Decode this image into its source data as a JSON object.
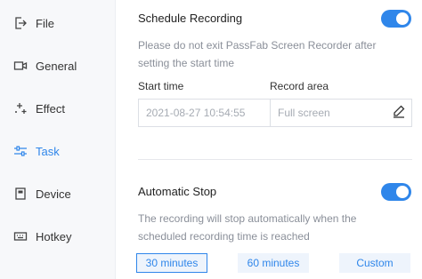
{
  "sidebar": {
    "items": [
      {
        "label": "File",
        "icon": "file-export-icon"
      },
      {
        "label": "General",
        "icon": "video-camera-icon"
      },
      {
        "label": "Effect",
        "icon": "sparkle-icon"
      },
      {
        "label": "Task",
        "icon": "sliders-icon",
        "active": true
      },
      {
        "label": "Device",
        "icon": "device-icon"
      },
      {
        "label": "Hotkey",
        "icon": "keyboard-icon"
      }
    ]
  },
  "schedule": {
    "title": "Schedule Recording",
    "enabled": true,
    "desc_line1": "Please do not exit PassFab Screen Recorder after",
    "desc_line2": "setting the start time",
    "start_time_label": "Start time",
    "record_area_label": "Record area",
    "start_time_value": "2021-08-27 10:54:55",
    "record_area_value": "Full screen"
  },
  "auto_stop": {
    "title": "Automatic Stop",
    "enabled": true,
    "desc_line1": "The recording will stop automatically when the",
    "desc_line2": "scheduled recording time is reached",
    "options": [
      "30 minutes",
      "60 minutes",
      "Custom"
    ],
    "selected": "30 minutes"
  },
  "colors": {
    "accent": "#2f86ea",
    "sidebar_bg": "#f7f8fa"
  }
}
